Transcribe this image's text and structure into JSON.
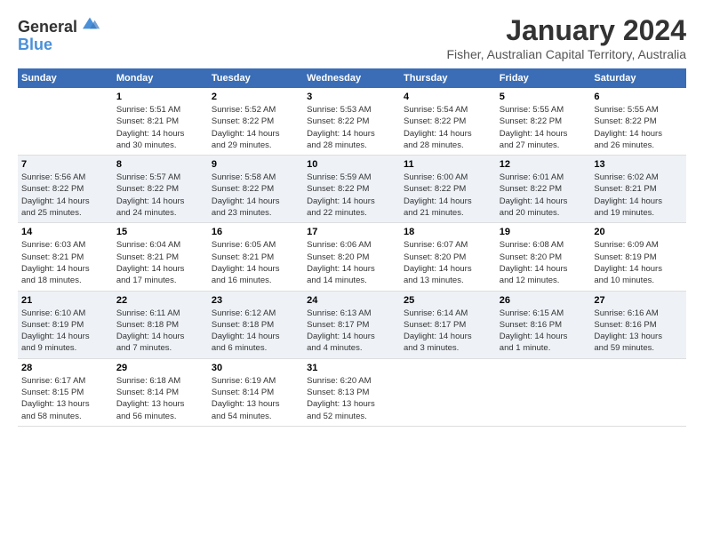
{
  "header": {
    "logo_line1": "General",
    "logo_line2": "Blue",
    "month_title": "January 2024",
    "location": "Fisher, Australian Capital Territory, Australia"
  },
  "days_of_week": [
    "Sunday",
    "Monday",
    "Tuesday",
    "Wednesday",
    "Thursday",
    "Friday",
    "Saturday"
  ],
  "weeks": [
    [
      {
        "day": "",
        "info": ""
      },
      {
        "day": "1",
        "info": "Sunrise: 5:51 AM\nSunset: 8:21 PM\nDaylight: 14 hours\nand 30 minutes."
      },
      {
        "day": "2",
        "info": "Sunrise: 5:52 AM\nSunset: 8:22 PM\nDaylight: 14 hours\nand 29 minutes."
      },
      {
        "day": "3",
        "info": "Sunrise: 5:53 AM\nSunset: 8:22 PM\nDaylight: 14 hours\nand 28 minutes."
      },
      {
        "day": "4",
        "info": "Sunrise: 5:54 AM\nSunset: 8:22 PM\nDaylight: 14 hours\nand 28 minutes."
      },
      {
        "day": "5",
        "info": "Sunrise: 5:55 AM\nSunset: 8:22 PM\nDaylight: 14 hours\nand 27 minutes."
      },
      {
        "day": "6",
        "info": "Sunrise: 5:55 AM\nSunset: 8:22 PM\nDaylight: 14 hours\nand 26 minutes."
      }
    ],
    [
      {
        "day": "7",
        "info": "Sunrise: 5:56 AM\nSunset: 8:22 PM\nDaylight: 14 hours\nand 25 minutes."
      },
      {
        "day": "8",
        "info": "Sunrise: 5:57 AM\nSunset: 8:22 PM\nDaylight: 14 hours\nand 24 minutes."
      },
      {
        "day": "9",
        "info": "Sunrise: 5:58 AM\nSunset: 8:22 PM\nDaylight: 14 hours\nand 23 minutes."
      },
      {
        "day": "10",
        "info": "Sunrise: 5:59 AM\nSunset: 8:22 PM\nDaylight: 14 hours\nand 22 minutes."
      },
      {
        "day": "11",
        "info": "Sunrise: 6:00 AM\nSunset: 8:22 PM\nDaylight: 14 hours\nand 21 minutes."
      },
      {
        "day": "12",
        "info": "Sunrise: 6:01 AM\nSunset: 8:22 PM\nDaylight: 14 hours\nand 20 minutes."
      },
      {
        "day": "13",
        "info": "Sunrise: 6:02 AM\nSunset: 8:21 PM\nDaylight: 14 hours\nand 19 minutes."
      }
    ],
    [
      {
        "day": "14",
        "info": "Sunrise: 6:03 AM\nSunset: 8:21 PM\nDaylight: 14 hours\nand 18 minutes."
      },
      {
        "day": "15",
        "info": "Sunrise: 6:04 AM\nSunset: 8:21 PM\nDaylight: 14 hours\nand 17 minutes."
      },
      {
        "day": "16",
        "info": "Sunrise: 6:05 AM\nSunset: 8:21 PM\nDaylight: 14 hours\nand 16 minutes."
      },
      {
        "day": "17",
        "info": "Sunrise: 6:06 AM\nSunset: 8:20 PM\nDaylight: 14 hours\nand 14 minutes."
      },
      {
        "day": "18",
        "info": "Sunrise: 6:07 AM\nSunset: 8:20 PM\nDaylight: 14 hours\nand 13 minutes."
      },
      {
        "day": "19",
        "info": "Sunrise: 6:08 AM\nSunset: 8:20 PM\nDaylight: 14 hours\nand 12 minutes."
      },
      {
        "day": "20",
        "info": "Sunrise: 6:09 AM\nSunset: 8:19 PM\nDaylight: 14 hours\nand 10 minutes."
      }
    ],
    [
      {
        "day": "21",
        "info": "Sunrise: 6:10 AM\nSunset: 8:19 PM\nDaylight: 14 hours\nand 9 minutes."
      },
      {
        "day": "22",
        "info": "Sunrise: 6:11 AM\nSunset: 8:18 PM\nDaylight: 14 hours\nand 7 minutes."
      },
      {
        "day": "23",
        "info": "Sunrise: 6:12 AM\nSunset: 8:18 PM\nDaylight: 14 hours\nand 6 minutes."
      },
      {
        "day": "24",
        "info": "Sunrise: 6:13 AM\nSunset: 8:17 PM\nDaylight: 14 hours\nand 4 minutes."
      },
      {
        "day": "25",
        "info": "Sunrise: 6:14 AM\nSunset: 8:17 PM\nDaylight: 14 hours\nand 3 minutes."
      },
      {
        "day": "26",
        "info": "Sunrise: 6:15 AM\nSunset: 8:16 PM\nDaylight: 14 hours\nand 1 minute."
      },
      {
        "day": "27",
        "info": "Sunrise: 6:16 AM\nSunset: 8:16 PM\nDaylight: 13 hours\nand 59 minutes."
      }
    ],
    [
      {
        "day": "28",
        "info": "Sunrise: 6:17 AM\nSunset: 8:15 PM\nDaylight: 13 hours\nand 58 minutes."
      },
      {
        "day": "29",
        "info": "Sunrise: 6:18 AM\nSunset: 8:14 PM\nDaylight: 13 hours\nand 56 minutes."
      },
      {
        "day": "30",
        "info": "Sunrise: 6:19 AM\nSunset: 8:14 PM\nDaylight: 13 hours\nand 54 minutes."
      },
      {
        "day": "31",
        "info": "Sunrise: 6:20 AM\nSunset: 8:13 PM\nDaylight: 13 hours\nand 52 minutes."
      },
      {
        "day": "",
        "info": ""
      },
      {
        "day": "",
        "info": ""
      },
      {
        "day": "",
        "info": ""
      }
    ]
  ]
}
